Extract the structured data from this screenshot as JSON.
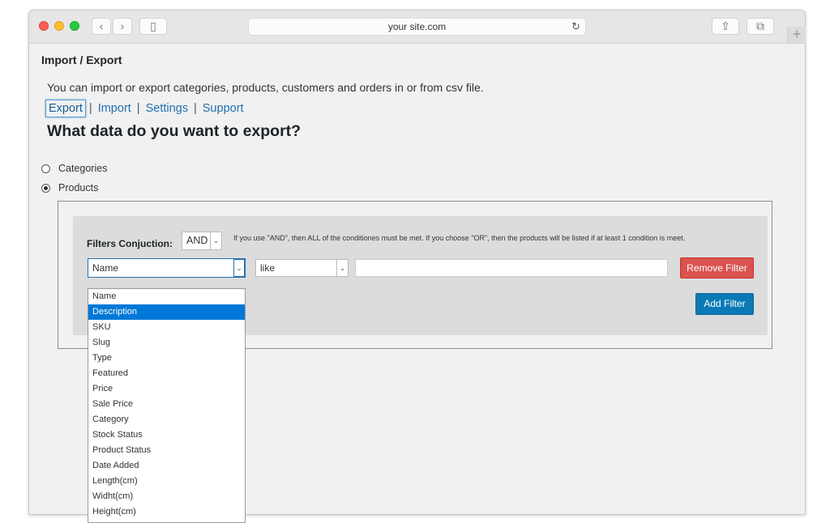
{
  "browser": {
    "url": "your site.com",
    "reload_icon": "↻",
    "back_icon": "‹",
    "forward_icon": "›",
    "sidebar_icon": "▯",
    "share_icon": "⇪",
    "tabs_icon": "⧉",
    "new_tab_icon": "+"
  },
  "page": {
    "title": "Import / Export",
    "intro": "You can import or export categories, products, customers and orders in or from csv file.",
    "tabs": [
      "Export",
      "Import",
      "Settings",
      "Support"
    ],
    "tab_separator": "|",
    "question": "What data do you want to export?"
  },
  "radios": [
    {
      "label": "Categories",
      "checked": false
    },
    {
      "label": "Products",
      "checked": true
    }
  ],
  "filters": {
    "conjunction_label": "Filters Conjuction:",
    "conjunction_value": "AND",
    "hint": "If you use \"AND\", then ALL of the conditiones must be met. If you choose \"OR\", then the products will be listed if at least 1 condition is meet.",
    "field_value": "Name",
    "operator_value": "like",
    "value_input": "",
    "remove_label": "Remove Filter",
    "add_label": "Add Filter",
    "chevron_icon": "⌄"
  },
  "dropdown_options": [
    "Name",
    "Description",
    "SKU",
    "Slug",
    "Type",
    "Featured",
    "Price",
    "Sale Price",
    "Category",
    "Stock Status",
    "Product Status",
    "Date Added",
    "Length(cm)",
    "Widht(cm)",
    "Height(cm)"
  ],
  "dropdown_highlighted": "Description",
  "colors": {
    "link": "#2271b1",
    "remove_button": "#d9534f",
    "add_button": "#0a7ab6",
    "highlight": "#0078d7"
  }
}
